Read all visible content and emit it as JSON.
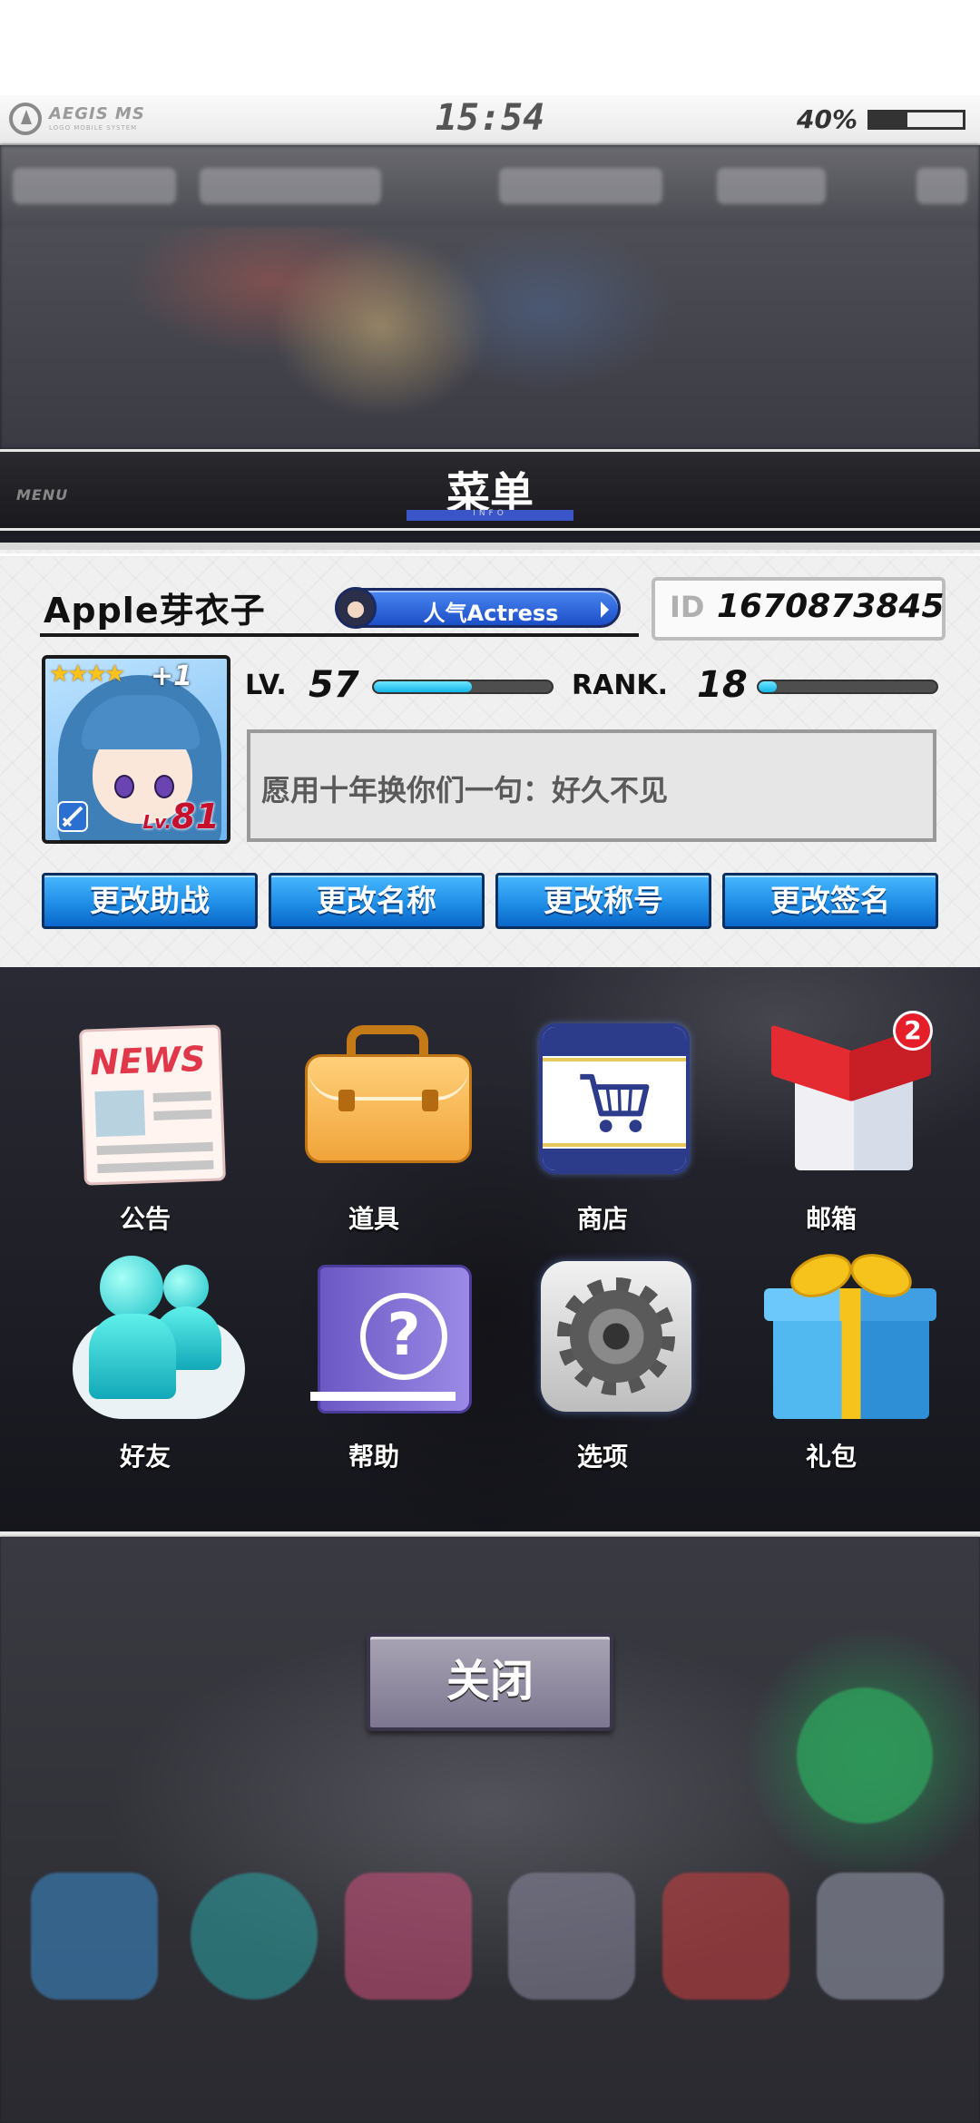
{
  "status_bar": {
    "brand": "AEGIS MS",
    "brand_sub": "LOGO MOBILE SYSTEM",
    "time": "15:54",
    "battery_text": "40%",
    "battery_level": 0.4
  },
  "header": {
    "small_label": "MENU",
    "title": "菜单",
    "subtitle": "INFO"
  },
  "profile": {
    "name": "Apple芽衣子",
    "title_badge": "人气Actress",
    "id_label": "ID",
    "id_value": "1670873845",
    "card": {
      "stars": "★★★★",
      "plus": "+1",
      "lv_prefix": "Lv.",
      "lv_value": "81"
    },
    "level_label": "LV.",
    "level_value": "57",
    "level_progress": 0.55,
    "rank_label": "RANK.",
    "rank_value": "18",
    "rank_progress": 0.1,
    "signature": "愿用十年换你们一句：好久不见",
    "buttons": [
      "更改助战",
      "更改名称",
      "更改称号",
      "更改签名"
    ]
  },
  "menu_grid": [
    {
      "label": "公告",
      "icon": "news-icon"
    },
    {
      "label": "道具",
      "icon": "briefcase-icon"
    },
    {
      "label": "商店",
      "icon": "shopping-cart-icon"
    },
    {
      "label": "邮箱",
      "icon": "mailbox-icon",
      "badge": "2"
    },
    {
      "label": "好友",
      "icon": "friends-icon"
    },
    {
      "label": "帮助",
      "icon": "help-book-icon"
    },
    {
      "label": "选项",
      "icon": "gear-icon"
    },
    {
      "label": "礼包",
      "icon": "gift-icon"
    }
  ],
  "news_icon_text": "NEWS",
  "close_label": "关闭",
  "colors": {
    "accent_blue": "#1f8ee6",
    "progress_cyan": "#12b5e8",
    "badge_red": "#e61e2a"
  }
}
